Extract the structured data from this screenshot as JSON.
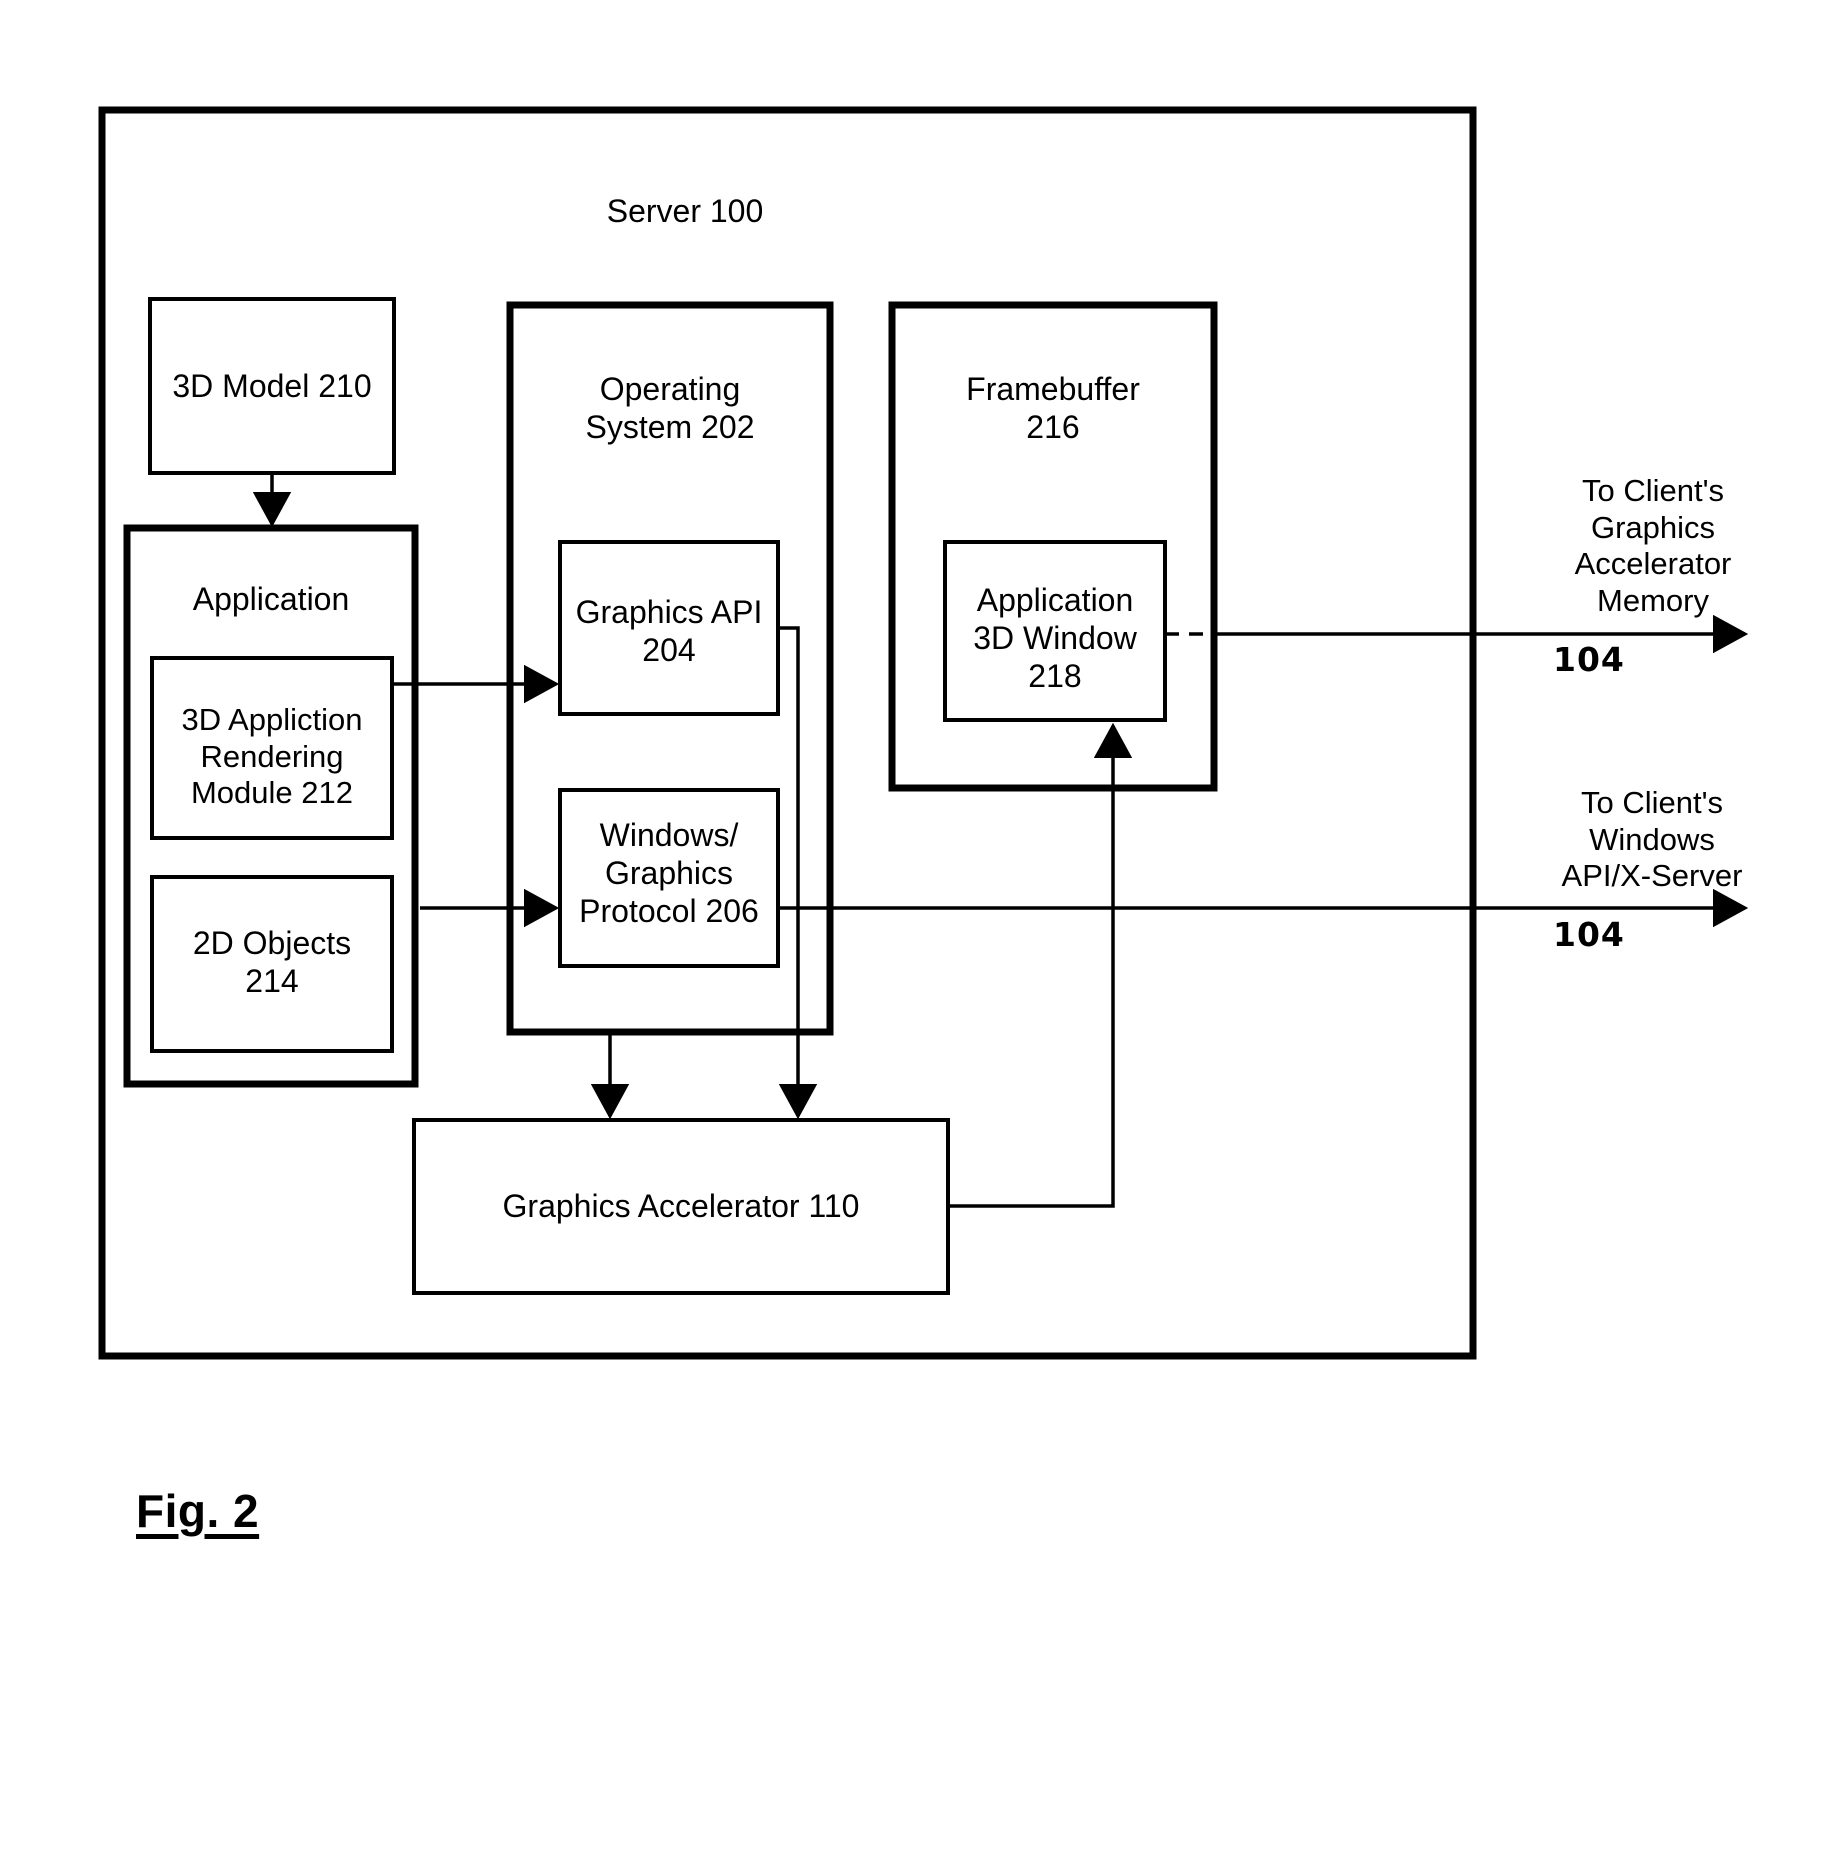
{
  "figure": {
    "caption": "Fig. 2",
    "title": "Server 100"
  },
  "boxes": {
    "server": {
      "label": "Server 100"
    },
    "model_3d": {
      "label": "3D Model 210"
    },
    "application": {
      "label": "Application"
    },
    "rendering_module": {
      "label": "3D Appliction\nRendering\nModule 212"
    },
    "objects_2d": {
      "label": "2D Objects\n214"
    },
    "operating_system": {
      "label": "Operating\nSystem 202"
    },
    "graphics_api": {
      "label": "Graphics API\n204"
    },
    "windows_protocol": {
      "label": "Windows/\nGraphics\nProtocol 206"
    },
    "framebuffer": {
      "label": "Framebuffer\n216"
    },
    "app_3d_window": {
      "label": "Application\n3D Window\n218"
    },
    "graphics_accelerator": {
      "label": "Graphics Accelerator 110"
    }
  },
  "external_labels": {
    "client_accelerator_memory": "To Client's\nGraphics\nAccelerator\nMemory",
    "client_accelerator_memory_ref": "104",
    "client_windows_api": "To Client's\nWindows\nAPI/X-Server",
    "client_windows_api_ref": "104"
  },
  "colors": {
    "stroke": "#000000",
    "background": "#ffffff"
  }
}
